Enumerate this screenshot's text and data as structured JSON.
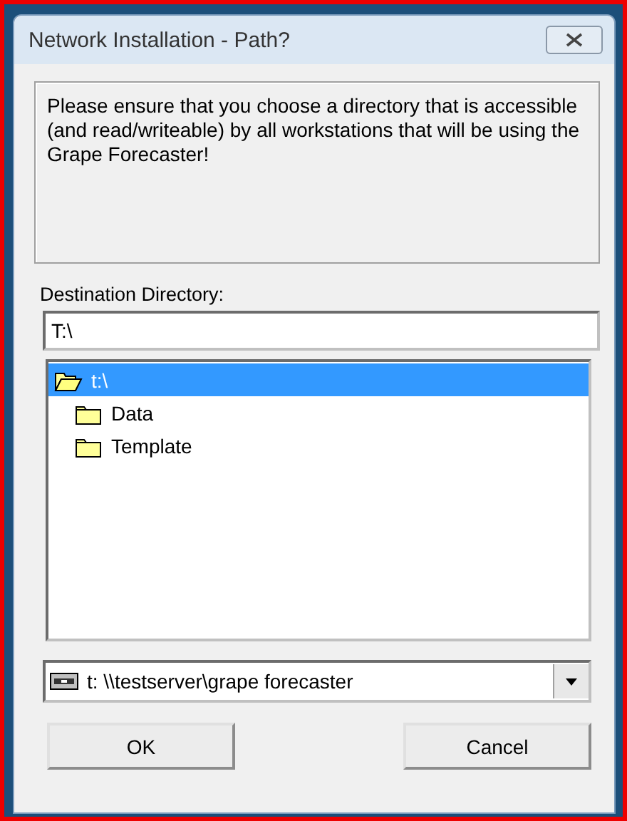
{
  "window": {
    "title": "Network Installation - Path?"
  },
  "message": "Please ensure that you choose a directory that is accessible (and read/writeable) by all workstations that will be using the Grape Forecaster!",
  "destination": {
    "label": "Destination Directory:",
    "value": "T:\\"
  },
  "folders": [
    {
      "name": "t:\\",
      "expanded": true,
      "selected": true,
      "children": [
        {
          "name": "Data",
          "expanded": false,
          "selected": false
        },
        {
          "name": "Template",
          "expanded": false,
          "selected": false
        }
      ]
    }
  ],
  "drive": {
    "value": "t:  \\\\testserver\\grape forecaster"
  },
  "buttons": [
    "OK",
    "Cancel"
  ]
}
